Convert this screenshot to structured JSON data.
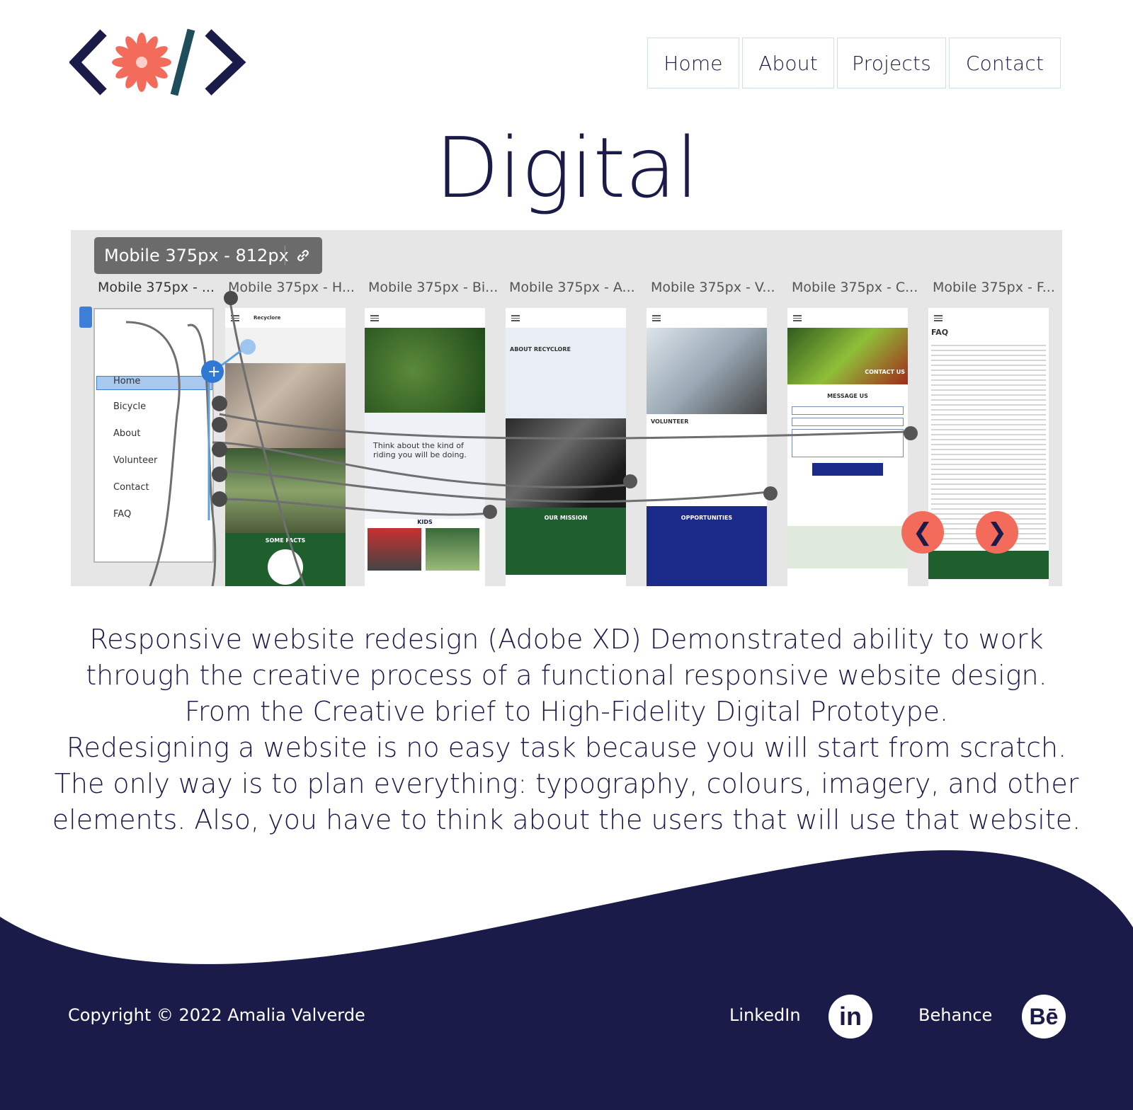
{
  "nav": {
    "home": "Home",
    "about": "About",
    "projects": "Projects",
    "contact": "Contact"
  },
  "page_title": "Digital",
  "prototype": {
    "artboard_tag": "Mobile 375px - 812px",
    "screen_labels": [
      "Mobile 375px - ...",
      "Mobile 375px - H...",
      "Mobile 375px - Bi...",
      "Mobile 375px - A...",
      "Mobile 375px - V...",
      "Mobile 375px - C...",
      "Mobile 375px - F..."
    ],
    "menu_items": [
      "Home",
      "Bicycle",
      "About",
      "Volunteer",
      "Contact",
      "FAQ"
    ],
    "screen_texts": {
      "about_title": "ABOUT RECYCLORE",
      "our_mission": "OUR MISSION",
      "volunteer": "VOLUNTEER",
      "opportunities": "OPPORTUNITIES",
      "contact_us": "CONTACT US",
      "message_us": "MESSAGE US",
      "faq": "FAQ",
      "kids": "KIDS",
      "some_facts": "SOME FACTS",
      "think": "Think about the kind of riding you will be doing.",
      "recyclore": "Recyclore"
    },
    "prev_arrow": "❮",
    "next_arrow": "❯"
  },
  "description": [
    "Responsive website redesign (Adobe XD) Demonstrated ability to work",
    "through the creative process of a functional responsive website design.",
    "From the Creative brief to High-Fidelity Digital Prototype.",
    "Redesigning a website is no easy task because you will start from scratch.",
    "The only way is to plan everything: typography, colours, imagery, and other",
    "elements. Also, you have to think about the users that will use that website."
  ],
  "footer": {
    "copyright": "Copyright © 2022 Amalia Valverde",
    "linkedin_label": "LinkedIn",
    "linkedin_icon": "in",
    "behance_label": "Behance",
    "behance_icon": "Bē"
  },
  "colors": {
    "navy": "#1b1b4a",
    "coral": "#f26b5b",
    "teal": "#1e4d5c"
  }
}
